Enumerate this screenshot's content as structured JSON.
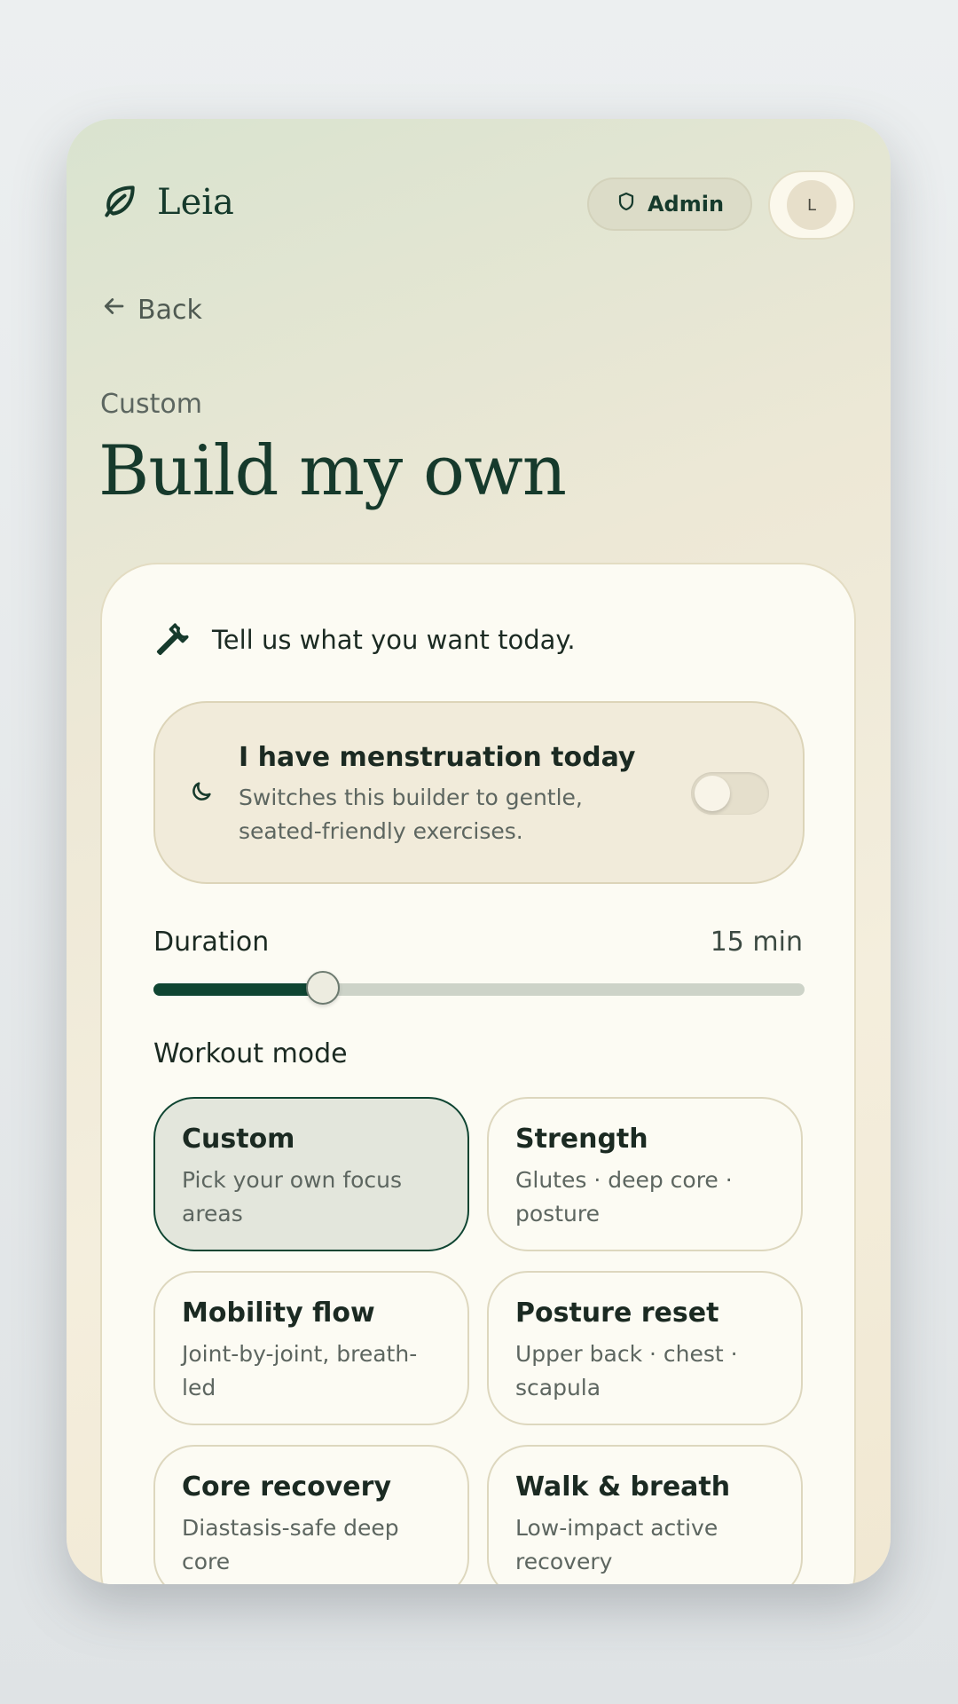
{
  "app": {
    "name": "Leia"
  },
  "header": {
    "admin_label": "Admin",
    "avatar_initial": "L"
  },
  "nav": {
    "back_label": "Back"
  },
  "page": {
    "eyebrow": "Custom",
    "title": "Build my own"
  },
  "builder": {
    "intro": "Tell us what you want today.",
    "menstruation": {
      "title": "I have menstruation today",
      "subtitle": "Switches this builder to gentle, seated-friendly exercises.",
      "enabled": false
    },
    "duration": {
      "label": "Duration",
      "value_text": "15 min",
      "fraction": 0.26
    },
    "mode_label": "Workout mode",
    "modes": [
      {
        "title": "Custom",
        "subtitle": "Pick your own focus areas",
        "selected": true
      },
      {
        "title": "Strength",
        "subtitle": "Glutes · deep core · posture",
        "selected": false
      },
      {
        "title": "Mobility flow",
        "subtitle": "Joint-by-joint, breath-led",
        "selected": false
      },
      {
        "title": "Posture reset",
        "subtitle": "Upper back · chest · scapula",
        "selected": false
      },
      {
        "title": "Core recovery",
        "subtitle": "Diastasis-safe deep core",
        "selected": false
      },
      {
        "title": "Walk & breath",
        "subtitle": "Low-impact active recovery",
        "selected": false
      }
    ]
  },
  "colors": {
    "accent": "#0f4532",
    "cream": "#fcfbf3",
    "pill": "#dcdcc8"
  },
  "icons": {
    "brand": "leaf-icon",
    "admin": "shield-icon",
    "back": "arrow-left-icon",
    "intro": "wrench-icon",
    "menstruation": "moon-icon"
  }
}
